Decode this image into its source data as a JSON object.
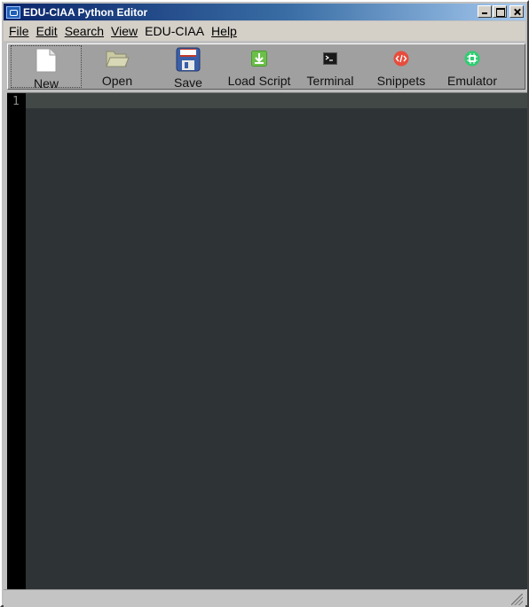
{
  "window": {
    "title": "EDU-CIAA Python Editor",
    "controls": {
      "minimize": "minimize",
      "maximize": "maximize",
      "close": "close"
    }
  },
  "menu": [
    {
      "label": "File"
    },
    {
      "label": "Edit"
    },
    {
      "label": "Search"
    },
    {
      "label": "View"
    },
    {
      "label": "EDU-CIAA"
    },
    {
      "label": "Help"
    }
  ],
  "toolbar": {
    "items": [
      {
        "label": "New",
        "icon": "new-document-icon",
        "active": true
      },
      {
        "label": "Open",
        "icon": "folder-open-icon"
      },
      {
        "label": "Save",
        "icon": "floppy-save-icon"
      },
      {
        "label": "Load Script",
        "icon": "download-icon",
        "color": "#6cc04a"
      },
      {
        "label": "Terminal",
        "icon": "terminal-icon",
        "color": "#1a1a1a"
      },
      {
        "label": "Snippets",
        "icon": "code-snippet-icon",
        "color": "#e74c3c"
      },
      {
        "label": "Emulator",
        "icon": "chip-icon",
        "color": "#2ecc71"
      }
    ]
  },
  "editor": {
    "line_numbers": [
      "1"
    ],
    "background": "#2e3436",
    "current_line_color": "#424845"
  }
}
